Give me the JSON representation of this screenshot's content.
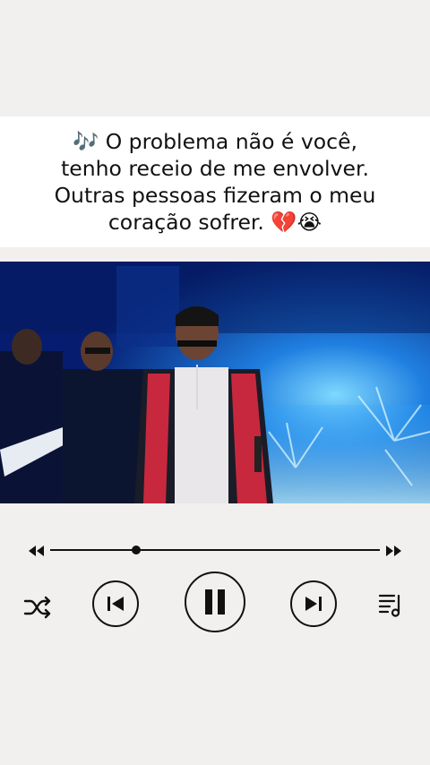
{
  "caption": {
    "lines": [
      "🎶 O problema não é você,",
      "tenho receio de me envolver.",
      "Outras pessoas fizeram o meu",
      "coração sofrer. 💔😭"
    ]
  },
  "player": {
    "progress": 0.26,
    "icons": {
      "rewind": "rewind-icon",
      "fast_forward": "fast-forward-icon",
      "shuffle": "shuffle-icon",
      "previous": "skip-previous-icon",
      "pause": "pause-icon",
      "next": "skip-next-icon",
      "playlist": "playlist-icon"
    }
  },
  "colors": {
    "background": "#f2f0ee",
    "caption_bg": "#ffffff",
    "icon": "#111111",
    "video_bg": "#06227a"
  }
}
